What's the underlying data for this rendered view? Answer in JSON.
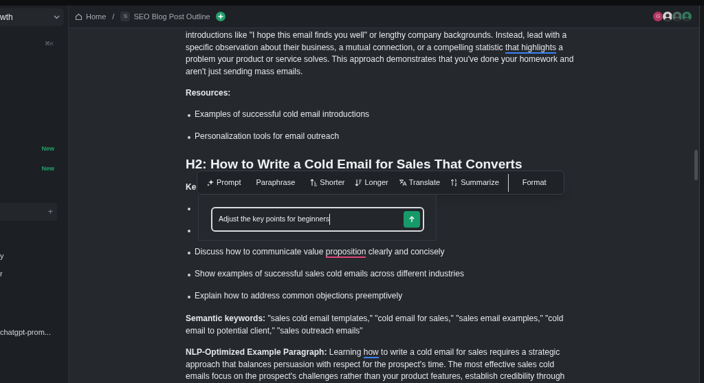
{
  "sidebar": {
    "items": [
      {
        "kind": "workspace",
        "label": "wth"
      },
      {
        "kind": "shortcut",
        "label": "⌘K"
      },
      {
        "kind": "badge",
        "label": "New"
      },
      {
        "kind": "badge",
        "label": "New"
      },
      {
        "kind": "add",
        "label": "+"
      },
      {
        "kind": "label",
        "label": "y"
      },
      {
        "kind": "label",
        "label": "r"
      },
      {
        "kind": "label",
        "label": "chatgpt-prom..."
      }
    ]
  },
  "breadcrumbs": {
    "home": "Home",
    "separator": "/",
    "page_initial": "S",
    "page": "SEO Blog Post Outline"
  },
  "avatars": [
    {
      "kind": "initial",
      "initial": "G",
      "color": "#b1365f"
    },
    {
      "kind": "person",
      "color": "#d9cfcf"
    },
    {
      "kind": "person",
      "color": "#4f6b5f"
    },
    {
      "kind": "person",
      "color": "#2f7a5a"
    }
  ],
  "document": {
    "blocks": [
      {
        "kind": "paragraph",
        "segments": [
          {
            "text": "introductions like \"I hope this email finds you well\" or lengthy company backgrounds. Instead, lead with a specific observation about their business, a mutual connection, or a compelling statistic "
          },
          {
            "text": "that highlights",
            "suggested": true
          },
          {
            "text": " a problem your product or service solves. This approach demonstrates that you've done your homework and aren't just sending mass emails."
          }
        ]
      },
      {
        "kind": "paragraph",
        "segments": [
          {
            "text": "Resources:",
            "bold": true
          }
        ]
      },
      {
        "kind": "bullets",
        "items": [
          "Examples of successful cold email introductions",
          "Personalization tools for email outreach"
        ]
      },
      {
        "kind": "heading",
        "text": "H2: How to Write a Cold Email for Sales That Converts"
      },
      {
        "kind": "paragraph",
        "segments": [
          {
            "text": "Ke",
            "bold": true
          }
        ]
      },
      {
        "kind": "covered_bullets"
      },
      {
        "kind": "bullet_rich",
        "segments": [
          {
            "text": "Discuss how to communicate value "
          },
          {
            "text": "proposition",
            "misspelled": true
          },
          {
            "text": " clearly and concisely"
          }
        ]
      },
      {
        "kind": "bullets",
        "items": [
          "Show examples of successful sales cold emails across different industries",
          "Explain how to address common objections preemptively"
        ]
      },
      {
        "kind": "paragraph",
        "segments": [
          {
            "text": "Semantic keywords:",
            "bold": true
          },
          {
            "text": " \"sales cold email templates,\" \"cold email for sales,\" \"sales email examples,\" \"cold email to potential client,\" \"sales outreach emails\""
          }
        ]
      },
      {
        "kind": "paragraph",
        "segments": [
          {
            "text": "NLP-Optimized Example Paragraph:",
            "bold": true
          },
          {
            "text": " Learning "
          },
          {
            "text": "how",
            "suggested": true
          },
          {
            "text": " to write a cold email for sales requires a strategic approach that balances persuasion with respect for the prospect's time. The most effective sales cold emails focus on the prospect's challenges rather than your product features, establish credibility through"
          }
        ]
      }
    ]
  },
  "ai_toolbar": {
    "actions": [
      {
        "kind": "prompt",
        "label": "Prompt"
      },
      {
        "kind": "plain",
        "label": "Paraphrase"
      },
      {
        "kind": "shorter",
        "label": "Shorter"
      },
      {
        "kind": "longer",
        "label": "Longer"
      },
      {
        "kind": "translate",
        "label": "Translate"
      },
      {
        "kind": "summarize",
        "label": "Summarize"
      },
      {
        "kind": "divider_plain",
        "label": "Format"
      }
    ]
  },
  "prompt_box": {
    "value": "Adjust the key points for beginners"
  }
}
